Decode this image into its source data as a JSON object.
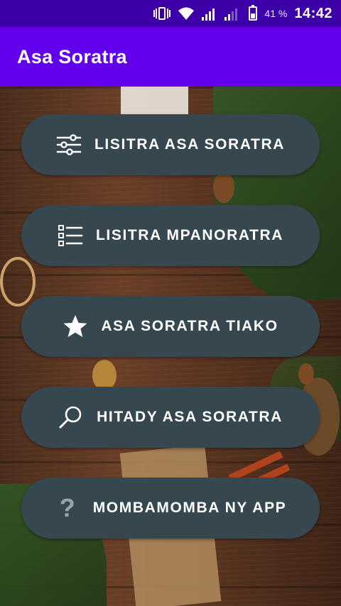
{
  "status": {
    "battery_pct": "41 %",
    "time": "14:42"
  },
  "appbar": {
    "title": "Asa Soratra"
  },
  "menu": {
    "items": [
      {
        "label": "LISITRA ASA SORATRA",
        "icon": "sliders-icon"
      },
      {
        "label": "LISITRA MPANORATRA",
        "icon": "list-icon"
      },
      {
        "label": "ASA SORATRA TIAKO",
        "icon": "star-icon"
      },
      {
        "label": "HITADY ASA SORATRA",
        "icon": "search-icon"
      },
      {
        "label": "MOMBAMOMBA NY APP",
        "icon": "help-icon"
      }
    ]
  },
  "colors": {
    "statusbar": "#3d00a8",
    "appbar": "#6200ee",
    "button": "#37474f"
  }
}
